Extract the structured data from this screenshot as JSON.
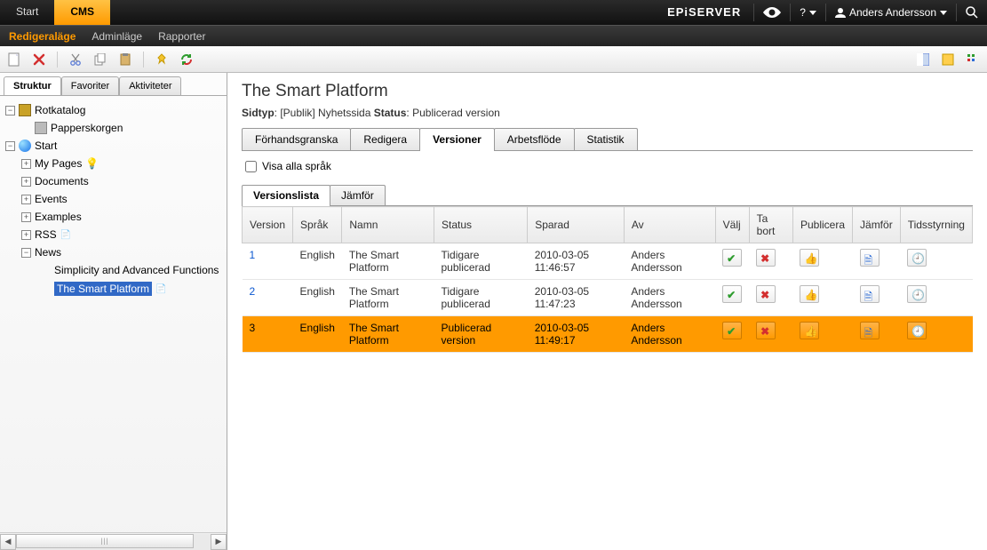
{
  "topbar": {
    "tabs": [
      {
        "label": "Start",
        "active": false
      },
      {
        "label": "CMS",
        "active": true
      }
    ],
    "logo": "EPiSERVER",
    "user": "Anders Andersson",
    "help": "?"
  },
  "secondbar": {
    "items": [
      {
        "label": "Redigeraläge",
        "active": true
      },
      {
        "label": "Adminläge",
        "active": false
      },
      {
        "label": "Rapporter",
        "active": false
      }
    ]
  },
  "left": {
    "tabs": [
      {
        "label": "Struktur",
        "active": true
      },
      {
        "label": "Favoriter",
        "active": false
      },
      {
        "label": "Aktiviteter",
        "active": false
      }
    ],
    "tree": {
      "root": "Rotkatalog",
      "trash": "Papperskorgen",
      "start": "Start",
      "children": [
        "My Pages",
        "Documents",
        "Events",
        "Examples",
        "RSS",
        "News"
      ],
      "news_children": [
        "Simplicity and Advanced Functions",
        "The Smart Platform"
      ]
    }
  },
  "page": {
    "title": "The Smart Platform",
    "sidtyp_label": "Sidtyp",
    "sidtyp_value": "[Publik] Nyhetssida",
    "status_label": "Status",
    "status_value": "Publicerad version"
  },
  "content_tabs": [
    {
      "label": "Förhandsgranska",
      "active": false
    },
    {
      "label": "Redigera",
      "active": false
    },
    {
      "label": "Versioner",
      "active": true
    },
    {
      "label": "Arbetsflöde",
      "active": false
    },
    {
      "label": "Statistik",
      "active": false
    }
  ],
  "show_all_languages": "Visa alla språk",
  "subtabs": [
    {
      "label": "Versionslista",
      "active": true
    },
    {
      "label": "Jämför",
      "active": false
    }
  ],
  "table": {
    "headers": [
      "Version",
      "Språk",
      "Namn",
      "Status",
      "Sparad",
      "Av",
      "Välj",
      "Ta bort",
      "Publicera",
      "Jämför",
      "Tidsstyrning"
    ],
    "rows": [
      {
        "version": "1",
        "sprak": "English",
        "namn": "The Smart Platform",
        "status": "Tidigare publicerad",
        "sparad": "2010-03-05 11:46:57",
        "av": "Anders Andersson",
        "selected": false
      },
      {
        "version": "2",
        "sprak": "English",
        "namn": "The Smart Platform",
        "status": "Tidigare publicerad",
        "sparad": "2010-03-05 11:47:23",
        "av": "Anders Andersson",
        "selected": false
      },
      {
        "version": "3",
        "sprak": "English",
        "namn": "The Smart Platform",
        "status": "Publicerad version",
        "sparad": "2010-03-05 11:49:17",
        "av": "Anders Andersson",
        "selected": true
      }
    ]
  }
}
